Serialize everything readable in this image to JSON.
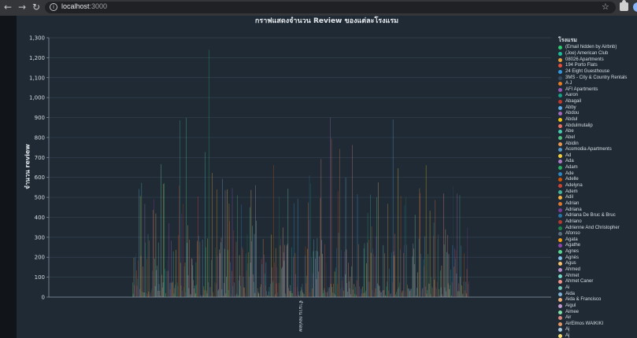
{
  "browser": {
    "url_host": "localhost",
    "url_port": ":3000",
    "back_glyph": "←",
    "forward_glyph": "→",
    "reload_glyph": "↻",
    "info_glyph": "i",
    "star_glyph": "☆"
  },
  "chart_data": {
    "type": "bar",
    "title": "กราฟแสดงจำนวน Review ของแต่ละโรงแรม",
    "ylabel": "จำนวน review",
    "categories": [
      "จำนวน review"
    ],
    "ylim": [
      0,
      1300
    ],
    "yticks": [
      "0",
      "100",
      "200",
      "300",
      "400",
      "500",
      "600",
      "700",
      "800",
      "900",
      "1,000",
      "1,100",
      "1,200",
      "1,300"
    ],
    "grid": true,
    "legend_position": "right",
    "legend_title": "โรงแรม",
    "legend": [
      {
        "name": "(Email hidden by Airbnb)",
        "color": "#2ecc71"
      },
      {
        "name": "(Joe) American Club",
        "color": "#1abc9c"
      },
      {
        "name": "08026 Apartments",
        "color": "#e6a33a"
      },
      {
        "name": "194 Porto Flats",
        "color": "#e74c3c"
      },
      {
        "name": "24 Eight Guesthouse",
        "color": "#3498db"
      },
      {
        "name": "3MS - City & Country Rentals",
        "color": "#34495e"
      },
      {
        "name": "A J",
        "color": "#e67e22"
      },
      {
        "name": "AFI Apartments",
        "color": "#9b59b6"
      },
      {
        "name": "Aaron",
        "color": "#16a085"
      },
      {
        "name": "Abagail",
        "color": "#c0392b"
      },
      {
        "name": "Abby",
        "color": "#5dade2"
      },
      {
        "name": "Abdou",
        "color": "#a569bd"
      },
      {
        "name": "Abdul",
        "color": "#f1c40f"
      },
      {
        "name": "Abdulmutalip",
        "color": "#ec7063"
      },
      {
        "name": "Abe",
        "color": "#48c9b0"
      },
      {
        "name": "Abel",
        "color": "#52be80"
      },
      {
        "name": "Abidin",
        "color": "#eb984e"
      },
      {
        "name": "Acomodia Apartments",
        "color": "#5499c7"
      },
      {
        "name": "Ad",
        "color": "#f4d03f"
      },
      {
        "name": "Ada",
        "color": "#af7ac5"
      },
      {
        "name": "Adam",
        "color": "#27ae60"
      },
      {
        "name": "Ade",
        "color": "#2e86c1"
      },
      {
        "name": "Adelle",
        "color": "#d35400"
      },
      {
        "name": "Adelyna",
        "color": "#cb4335"
      },
      {
        "name": "Adem",
        "color": "#45b39d"
      },
      {
        "name": "Adil",
        "color": "#f5b041"
      },
      {
        "name": "Adrian",
        "color": "#dc7633"
      },
      {
        "name": "Adriana",
        "color": "#7d3c98"
      },
      {
        "name": "Adriana De Bruc & Bruc",
        "color": "#2874a6"
      },
      {
        "name": "Adriano",
        "color": "#b03a2e"
      },
      {
        "name": "Adrienne And Christopher",
        "color": "#1e8449"
      },
      {
        "name": "Afonso",
        "color": "#5d6d7e"
      },
      {
        "name": "Agata",
        "color": "#f39c12"
      },
      {
        "name": "Agathe",
        "color": "#8e44ad"
      },
      {
        "name": "Agnes",
        "color": "#58d68d"
      },
      {
        "name": "Agnès",
        "color": "#85c1e9"
      },
      {
        "name": "Agus",
        "color": "#f8c471"
      },
      {
        "name": "Ahmed",
        "color": "#bb8fce"
      },
      {
        "name": "Ahmet",
        "color": "#76d7c4"
      },
      {
        "name": "Ahmet Caner",
        "color": "#f1948a"
      },
      {
        "name": "Ai",
        "color": "#73c6b6"
      },
      {
        "name": "Aida",
        "color": "#7fb3d5"
      },
      {
        "name": "Aida & Francisco",
        "color": "#f0b27a"
      },
      {
        "name": "Aigul",
        "color": "#c39bd3"
      },
      {
        "name": "Aimee",
        "color": "#82e0aa"
      },
      {
        "name": "Air",
        "color": "#d98880"
      },
      {
        "name": "AirElmos WAIKIKI",
        "color": "#e59866"
      },
      {
        "name": "Aj",
        "color": "#a9cce3"
      },
      {
        "name": "Aj",
        "color": "#f7dc6f"
      }
    ]
  }
}
